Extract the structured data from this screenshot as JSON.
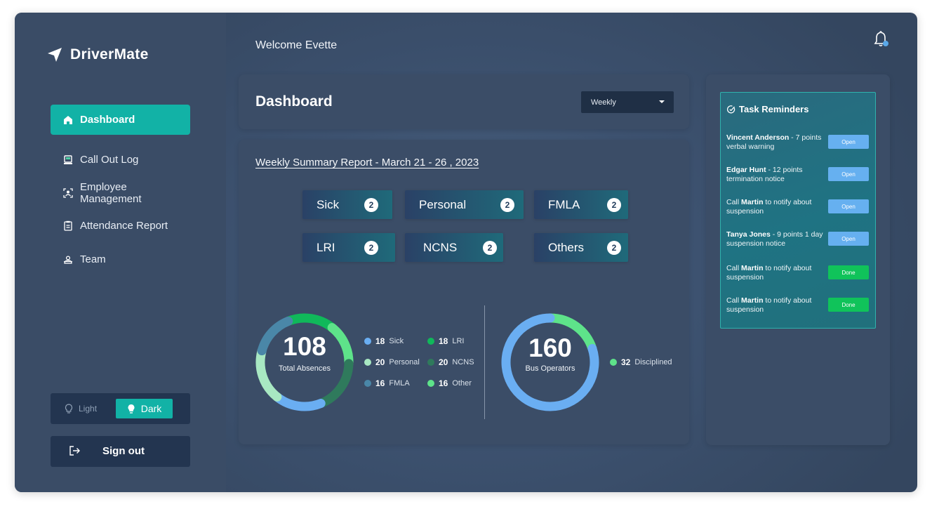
{
  "app": {
    "name": "DriverMate"
  },
  "header": {
    "welcome": "Welcome Evette",
    "bell_icon": "bell-icon"
  },
  "sidebar": {
    "items": [
      {
        "label": "Dashboard",
        "icon": "home-icon",
        "active": true
      },
      {
        "label": "Call Out Log",
        "icon": "phone-log-icon"
      },
      {
        "label": "Employee Management",
        "icon": "id-badge-icon"
      },
      {
        "label": "Attendance Report",
        "icon": "clipboard-icon"
      },
      {
        "label": "Team",
        "icon": "team-icon"
      }
    ],
    "theme": {
      "light": "Light",
      "dark": "Dark"
    },
    "signout": "Sign out"
  },
  "dashboard": {
    "title": "Dashboard",
    "period": "Weekly",
    "summary_title": "Weekly Summary Report - March 21 - 26 , 2023",
    "categories": [
      {
        "label": "Sick",
        "count": "2"
      },
      {
        "label": "Personal",
        "count": "2"
      },
      {
        "label": "FMLA",
        "count": "2"
      },
      {
        "label": "LRI",
        "count": "2"
      },
      {
        "label": "NCNS",
        "count": "2"
      },
      {
        "label": "Others",
        "count": "2"
      }
    ],
    "absences": {
      "total": "108",
      "label": "Total Absences",
      "legend": [
        {
          "value": "18",
          "label": "Sick",
          "color": "#6aaef2"
        },
        {
          "value": "20",
          "label": "Personal",
          "color": "#a8e8c2"
        },
        {
          "value": "16",
          "label": "FMLA",
          "color": "#4a87a8"
        },
        {
          "value": "18",
          "label": "LRI",
          "color": "#10b85a"
        },
        {
          "value": "20",
          "label": "NCNS",
          "color": "#2f7a5c"
        },
        {
          "value": "16",
          "label": "Other",
          "color": "#5ee38a"
        }
      ]
    },
    "operators": {
      "total": "160",
      "label": "Bus Operators",
      "legend": [
        {
          "value": "32",
          "label": "Disciplined",
          "color": "#5ee38a"
        }
      ],
      "colors": {
        "main": "#6aaef2",
        "disciplined": "#5ee38a"
      }
    }
  },
  "tasks": {
    "title": "Task Reminders",
    "items": [
      {
        "bold": "Vincent Anderson",
        "pre": "",
        "rest": " - 7 points verbal warning",
        "action": "Open",
        "state": "open"
      },
      {
        "bold": "Edgar Hunt",
        "pre": "",
        "rest": " - 12 points termination notice",
        "action": "Open",
        "state": "open"
      },
      {
        "pre": "Call ",
        "bold": "Martin",
        "rest": " to notify about suspension",
        "action": "Open",
        "state": "open"
      },
      {
        "bold": "Tanya Jones",
        "pre": "",
        "rest": " - 9 points 1 day suspension notice",
        "action": "Open",
        "state": "open"
      },
      {
        "pre": "Call ",
        "bold": "Martin",
        "rest": " to notify about suspension",
        "action": "Done",
        "state": "done"
      },
      {
        "pre": "Call ",
        "bold": "Martin",
        "rest": " to notify about suspension",
        "action": "Done",
        "state": "done"
      }
    ]
  }
}
